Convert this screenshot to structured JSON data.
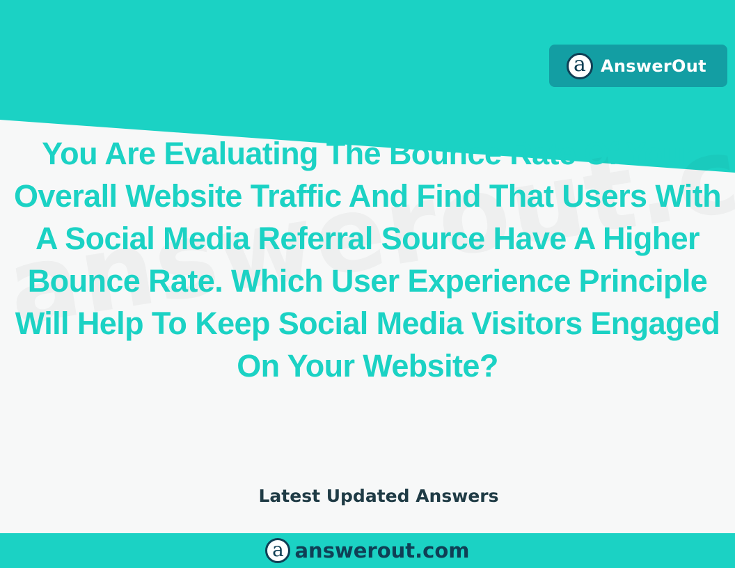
{
  "brand": {
    "logo_letter": "a",
    "name": "AnswerOut"
  },
  "watermark": "answerout.com",
  "question": "You Are Evaluating The Bounce Rate Of Your Overall Website Traffic And Find That Users With A Social Media Referral Source Have A Higher Bounce Rate. Which User Experience Principle Will Help To Keep Social Media Visitors Engaged On Your Website?",
  "subheading": "Latest Updated Answers",
  "footer": {
    "logo_letter": "a",
    "domain": "answerout.com"
  },
  "colors": {
    "teal": "#1bd2c4",
    "badge": "#139ea3",
    "navy": "#0f3f55",
    "dark_text": "#1f3b45",
    "background": "#f7f8f8"
  }
}
